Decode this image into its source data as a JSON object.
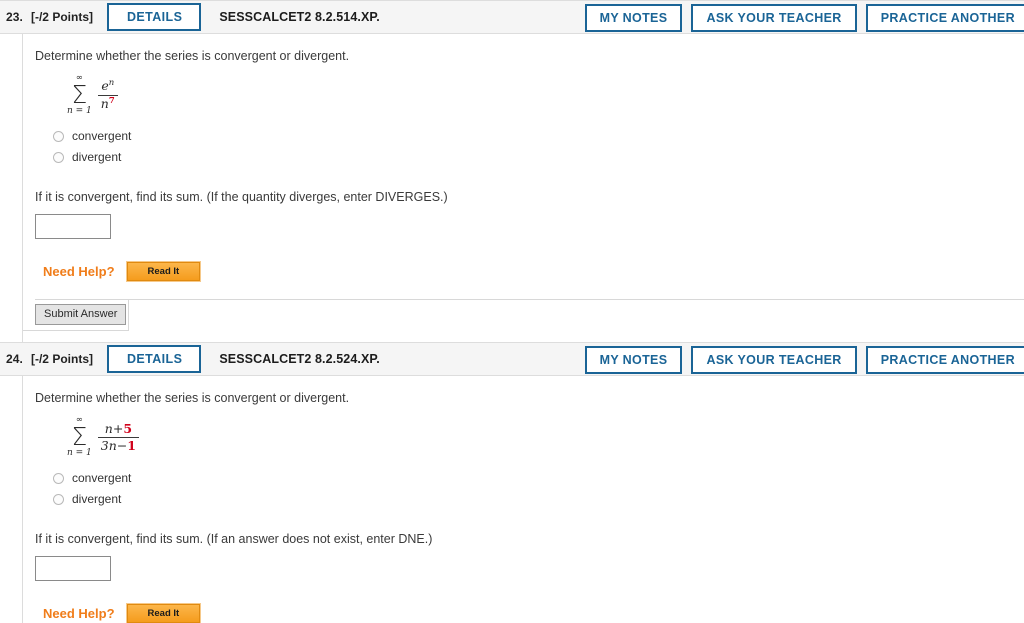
{
  "questions": [
    {
      "number": "23.",
      "points": "[-/2 Points]",
      "details_label": "DETAILS",
      "code": "SESSCALCET2 8.2.514.XP.",
      "actions": {
        "my_notes": "MY NOTES",
        "ask_your_teacher": "ASK YOUR TEACHER",
        "practice_another": "PRACTICE ANOTHER"
      },
      "prompt": "Determine whether the series is convergent or divergent.",
      "math": {
        "sigma_top": "∞",
        "sigma_bottom": "n = 1",
        "numerator_base": "e",
        "numerator_exp": "n",
        "denominator_base": "n",
        "denominator_exp": "7"
      },
      "choices": [
        {
          "label": "convergent",
          "selected": false
        },
        {
          "label": "divergent",
          "selected": false
        }
      ],
      "subprompt": "If it is convergent, find its sum. (If the quantity diverges, enter DIVERGES.)",
      "answer_value": "",
      "need_help_label": "Need Help?",
      "read_it_label": "Read It",
      "submit_label": "Submit Answer"
    },
    {
      "number": "24.",
      "points": "[-/2 Points]",
      "details_label": "DETAILS",
      "code": "SESSCALCET2 8.2.524.XP.",
      "actions": {
        "my_notes": "MY NOTES",
        "ask_your_teacher": "ASK YOUR TEACHER",
        "practice_another": "PRACTICE ANOTHER"
      },
      "prompt": "Determine whether the series is convergent or divergent.",
      "math": {
        "sigma_top": "∞",
        "sigma_bottom": "n = 1",
        "num_var": "n",
        "num_op": "+",
        "num_const": "5",
        "den_coef": "3n",
        "den_op": "−",
        "den_const": "1"
      },
      "choices": [
        {
          "label": "convergent",
          "selected": false
        },
        {
          "label": "divergent",
          "selected": false
        }
      ],
      "subprompt": "If it is convergent, find its sum. (If an answer does not exist, enter DNE.)",
      "answer_value": "",
      "need_help_label": "Need Help?",
      "read_it_label": "Read It"
    }
  ],
  "colors": {
    "accent_blue": "#1a6496",
    "help_orange": "#f07d1a",
    "math_red": "#d0021b",
    "header_bg": "#f5f5f5"
  }
}
